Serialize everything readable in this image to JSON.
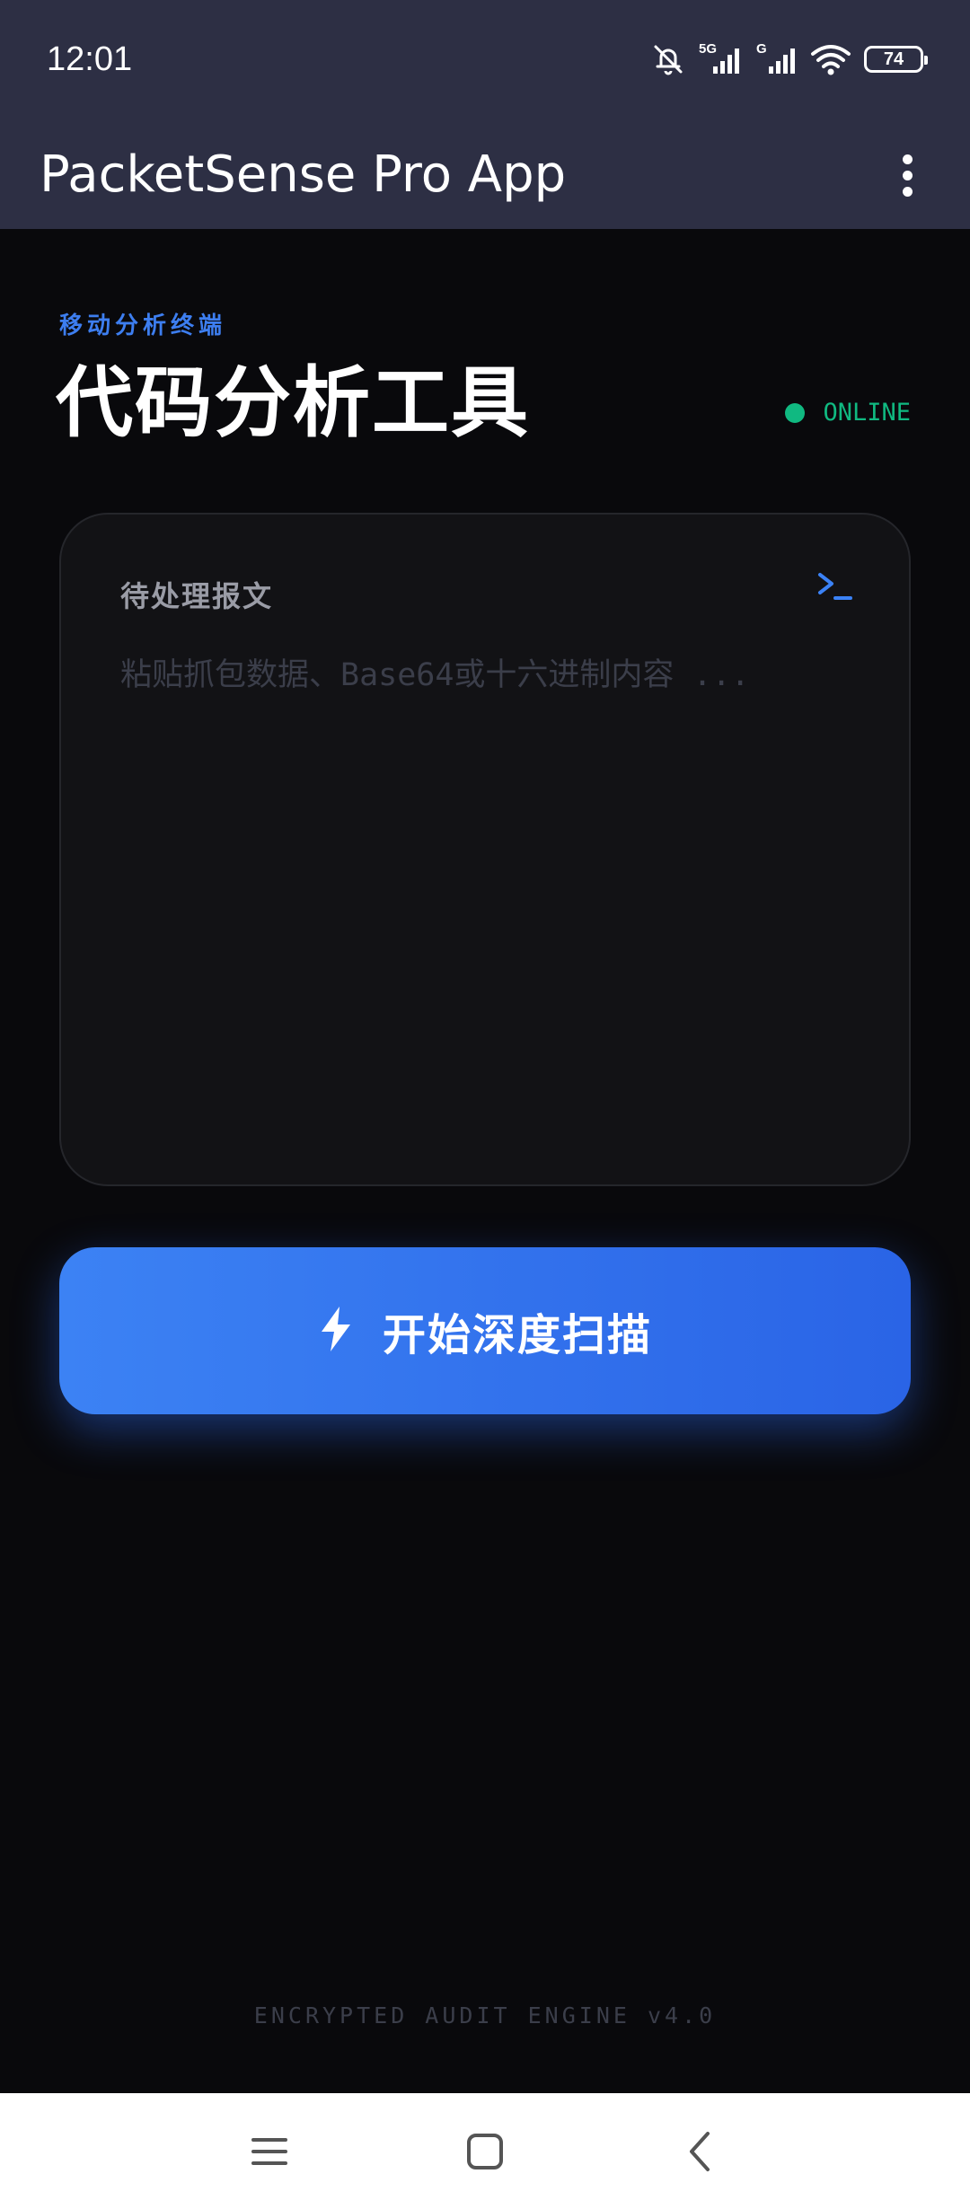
{
  "status_bar": {
    "time": "12:01",
    "network_1": "5G",
    "network_2": "G",
    "battery_level": "74",
    "icons": [
      "mute-icon",
      "signal-5g-icon",
      "signal-g-icon",
      "wifi-icon",
      "battery-icon"
    ]
  },
  "app_bar": {
    "title": "PacketSense Pro App",
    "menu_icon": "more-vert-icon"
  },
  "header": {
    "subtitle": "移动分析终端",
    "title": "代码分析工具",
    "status": "ONLINE",
    "status_color": "#10b981"
  },
  "input_card": {
    "label": "待处理报文",
    "icon": "terminal-icon",
    "value": "",
    "placeholder": "粘贴抓包数据、Base64或十六进制内容 ..."
  },
  "scan_button": {
    "label": "开始深度扫描",
    "icon": "bolt-icon",
    "color": "#3b82f6"
  },
  "footer": {
    "text": "ENCRYPTED AUDIT ENGINE v4.0"
  },
  "nav_bar": {
    "items": [
      "menu-icon",
      "home-icon",
      "back-icon"
    ]
  }
}
